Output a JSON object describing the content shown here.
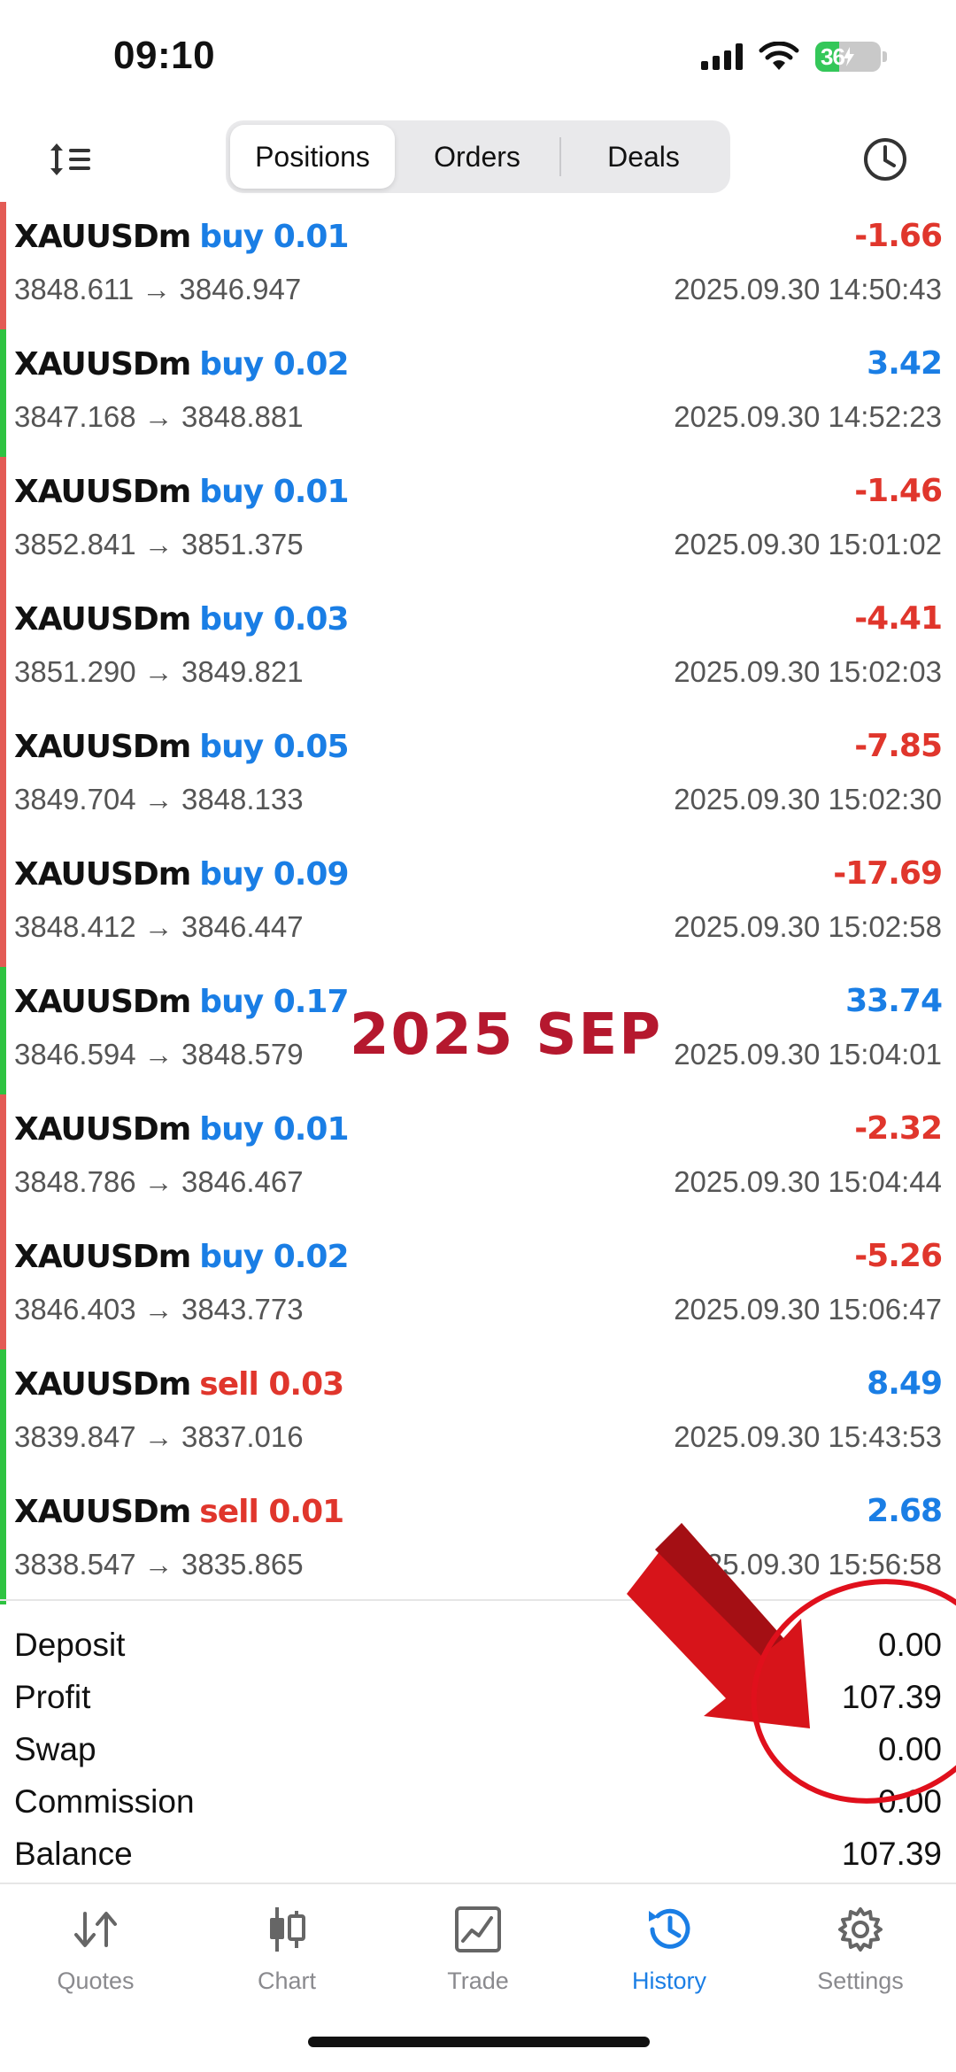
{
  "status_bar": {
    "time": "09:10",
    "battery_level": "36",
    "battery_fraction": 0.36,
    "icons": [
      "cellular-signal-icon",
      "wifi-icon",
      "battery-charging-icon"
    ]
  },
  "toolbar": {
    "sort_icon": "sort-list-icon",
    "tabs": [
      {
        "label": "Positions",
        "active": true
      },
      {
        "label": "Orders",
        "active": false
      },
      {
        "label": "Deals",
        "active": false
      }
    ],
    "period_icon": "clock-icon"
  },
  "colors": {
    "accent_blue": "#1a7ee5",
    "loss_red": "#e0362c",
    "profit_bar_green": "#2ec341",
    "loss_bar_red": "#e35b55",
    "watermark": "#b5182e"
  },
  "deals": [
    {
      "symbol": "XAUUSDm",
      "side": "buy 0.01",
      "side_type": "buy",
      "profit": "-1.66",
      "positive": false,
      "prices": "3848.611 → 3846.947",
      "time": "2025.09.30 14:50:43"
    },
    {
      "symbol": "XAUUSDm",
      "side": "buy 0.02",
      "side_type": "buy",
      "profit": "3.42",
      "positive": true,
      "prices": "3847.168 → 3848.881",
      "time": "2025.09.30 14:52:23"
    },
    {
      "symbol": "XAUUSDm",
      "side": "buy 0.01",
      "side_type": "buy",
      "profit": "-1.46",
      "positive": false,
      "prices": "3852.841 → 3851.375",
      "time": "2025.09.30 15:01:02"
    },
    {
      "symbol": "XAUUSDm",
      "side": "buy 0.03",
      "side_type": "buy",
      "profit": "-4.41",
      "positive": false,
      "prices": "3851.290 → 3849.821",
      "time": "2025.09.30 15:02:03"
    },
    {
      "symbol": "XAUUSDm",
      "side": "buy 0.05",
      "side_type": "buy",
      "profit": "-7.85",
      "positive": false,
      "prices": "3849.704 → 3848.133",
      "time": "2025.09.30 15:02:30"
    },
    {
      "symbol": "XAUUSDm",
      "side": "buy 0.09",
      "side_type": "buy",
      "profit": "-17.69",
      "positive": false,
      "prices": "3848.412 → 3846.447",
      "time": "2025.09.30 15:02:58"
    },
    {
      "symbol": "XAUUSDm",
      "side": "buy 0.17",
      "side_type": "buy",
      "profit": "33.74",
      "positive": true,
      "prices": "3846.594 → 3848.579",
      "time": "2025.09.30 15:04:01"
    },
    {
      "symbol": "XAUUSDm",
      "side": "buy 0.01",
      "side_type": "buy",
      "profit": "-2.32",
      "positive": false,
      "prices": "3848.786 → 3846.467",
      "time": "2025.09.30 15:04:44"
    },
    {
      "symbol": "XAUUSDm",
      "side": "buy 0.02",
      "side_type": "buy",
      "profit": "-5.26",
      "positive": false,
      "prices": "3846.403 → 3843.773",
      "time": "2025.09.30 15:06:47"
    },
    {
      "symbol": "XAUUSDm",
      "side": "sell 0.03",
      "side_type": "sell",
      "profit": "8.49",
      "positive": true,
      "prices": "3839.847 → 3837.016",
      "time": "2025.09.30 15:43:53"
    },
    {
      "symbol": "XAUUSDm",
      "side": "sell 0.01",
      "side_type": "sell",
      "profit": "2.68",
      "positive": true,
      "prices": "3838.547 → 3835.865",
      "time": "2025.09.30 15:56:58"
    }
  ],
  "watermark_text": "2025 SEP",
  "summary": {
    "deposit_label": "Deposit",
    "deposit_value": "0.00",
    "profit_label": "Profit",
    "profit_value": "107.39",
    "swap_label": "Swap",
    "swap_value": "0.00",
    "commission_label": "Commission",
    "commission_value": "0.00",
    "balance_label": "Balance",
    "balance_value": "107.39"
  },
  "tabbar": {
    "items": [
      {
        "label": "Quotes",
        "icon": "quotes-arrows-icon",
        "active": false
      },
      {
        "label": "Chart",
        "icon": "candlestick-chart-icon",
        "active": false
      },
      {
        "label": "Trade",
        "icon": "trade-chart-icon",
        "active": false
      },
      {
        "label": "History",
        "icon": "history-clock-icon",
        "active": true
      },
      {
        "label": "Settings",
        "icon": "gear-icon",
        "active": false
      }
    ]
  }
}
